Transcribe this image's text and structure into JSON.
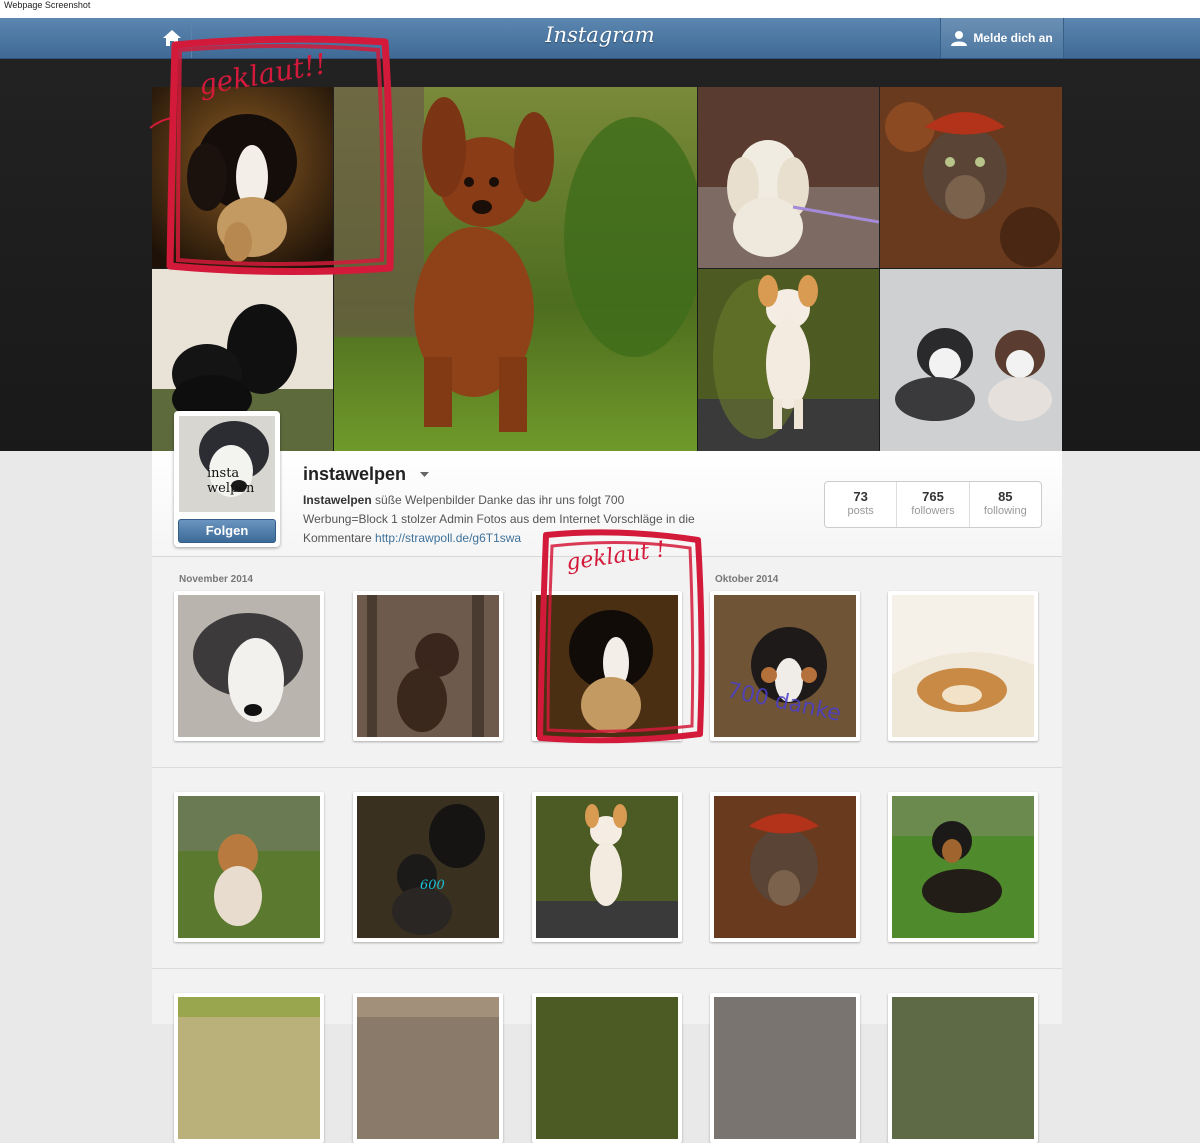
{
  "caption": "Webpage Screenshot",
  "header": {
    "logo": "Instagram",
    "login_label": "Melde dich an",
    "home_icon": "home-icon",
    "user_icon": "user-icon"
  },
  "profile": {
    "username": "instawelpen",
    "follow_label": "Folgen",
    "bio_name": "Instawelpen",
    "bio_line1": " süße Welpenbilder  Danke das ihr uns folgt  700",
    "bio_line2": "Werbung=Block 1 stolzer Admin  Fotos aus dem Internet  Vorschläge in die",
    "bio_line3": "Kommentare ",
    "bio_link": "http://strawpoll.de/g6T1swa",
    "avatar_text": "insta welpen"
  },
  "stats": [
    {
      "num": "73",
      "label": "posts"
    },
    {
      "num": "765",
      "label": "followers"
    },
    {
      "num": "85",
      "label": "following"
    }
  ],
  "feed": {
    "month_1": "November 2014",
    "month_2": "Oktober 2014"
  },
  "annotations": {
    "top_note": "geklaut!!",
    "feed_note": "geklaut !",
    "watermark_700": "700 danke",
    "watermark_600": "600"
  },
  "colors": {
    "brand_blue": "#3f6a95",
    "annotation_red": "#d31a3a",
    "link_blue": "#3f729b"
  }
}
